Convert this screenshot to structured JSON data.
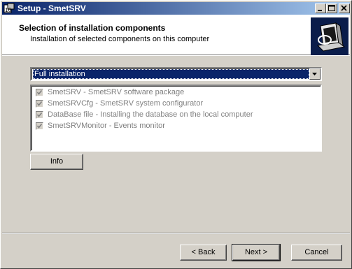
{
  "window": {
    "title": "Setup - SmetSRV",
    "icon": "setup-app-icon"
  },
  "header": {
    "title": "Selection of installation components",
    "subtitle": "Installation of selected components on this computer",
    "logo": "computer-install-icon"
  },
  "install_type": {
    "selected": "Full installation"
  },
  "components": [
    {
      "label": "SmetSRV - SmetSRV software package",
      "checked": true,
      "enabled": false
    },
    {
      "label": "SmetSRVCfg - SmetSRV system configurator",
      "checked": true,
      "enabled": false
    },
    {
      "label": "DataBase file - Installing the database on the local computer",
      "checked": true,
      "enabled": false
    },
    {
      "label": "SmetSRVMonitor - Events monitor",
      "checked": true,
      "enabled": false
    }
  ],
  "buttons": {
    "info": "Info",
    "back": "< Back",
    "next": "Next >",
    "cancel": "Cancel"
  }
}
